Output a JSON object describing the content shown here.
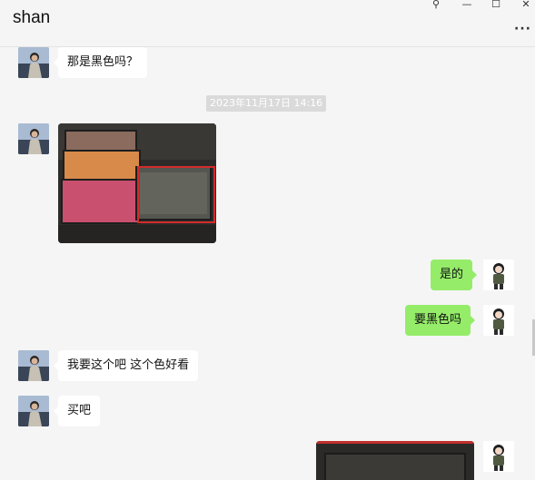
{
  "window": {
    "title": "shan",
    "pin_glyph": "⚲",
    "minimize_glyph": "—",
    "maximize_glyph": "☐",
    "close_glyph": "✕",
    "more_glyph": "···"
  },
  "messages": {
    "m1": "那是黑色吗？",
    "timestamp": "2023年11月17日 14:16",
    "m3": "是的",
    "m4": "要黑色吗",
    "m5": "我要这个吧 这个色好看",
    "m6": "买吧"
  },
  "colors": {
    "sent_bubble": "#95ec69",
    "received_bubble": "#ffffff",
    "highlight_box": "#d12c2c"
  },
  "icons": [
    "pin-icon",
    "minimize-icon",
    "maximize-icon",
    "close-icon",
    "more-icon"
  ]
}
